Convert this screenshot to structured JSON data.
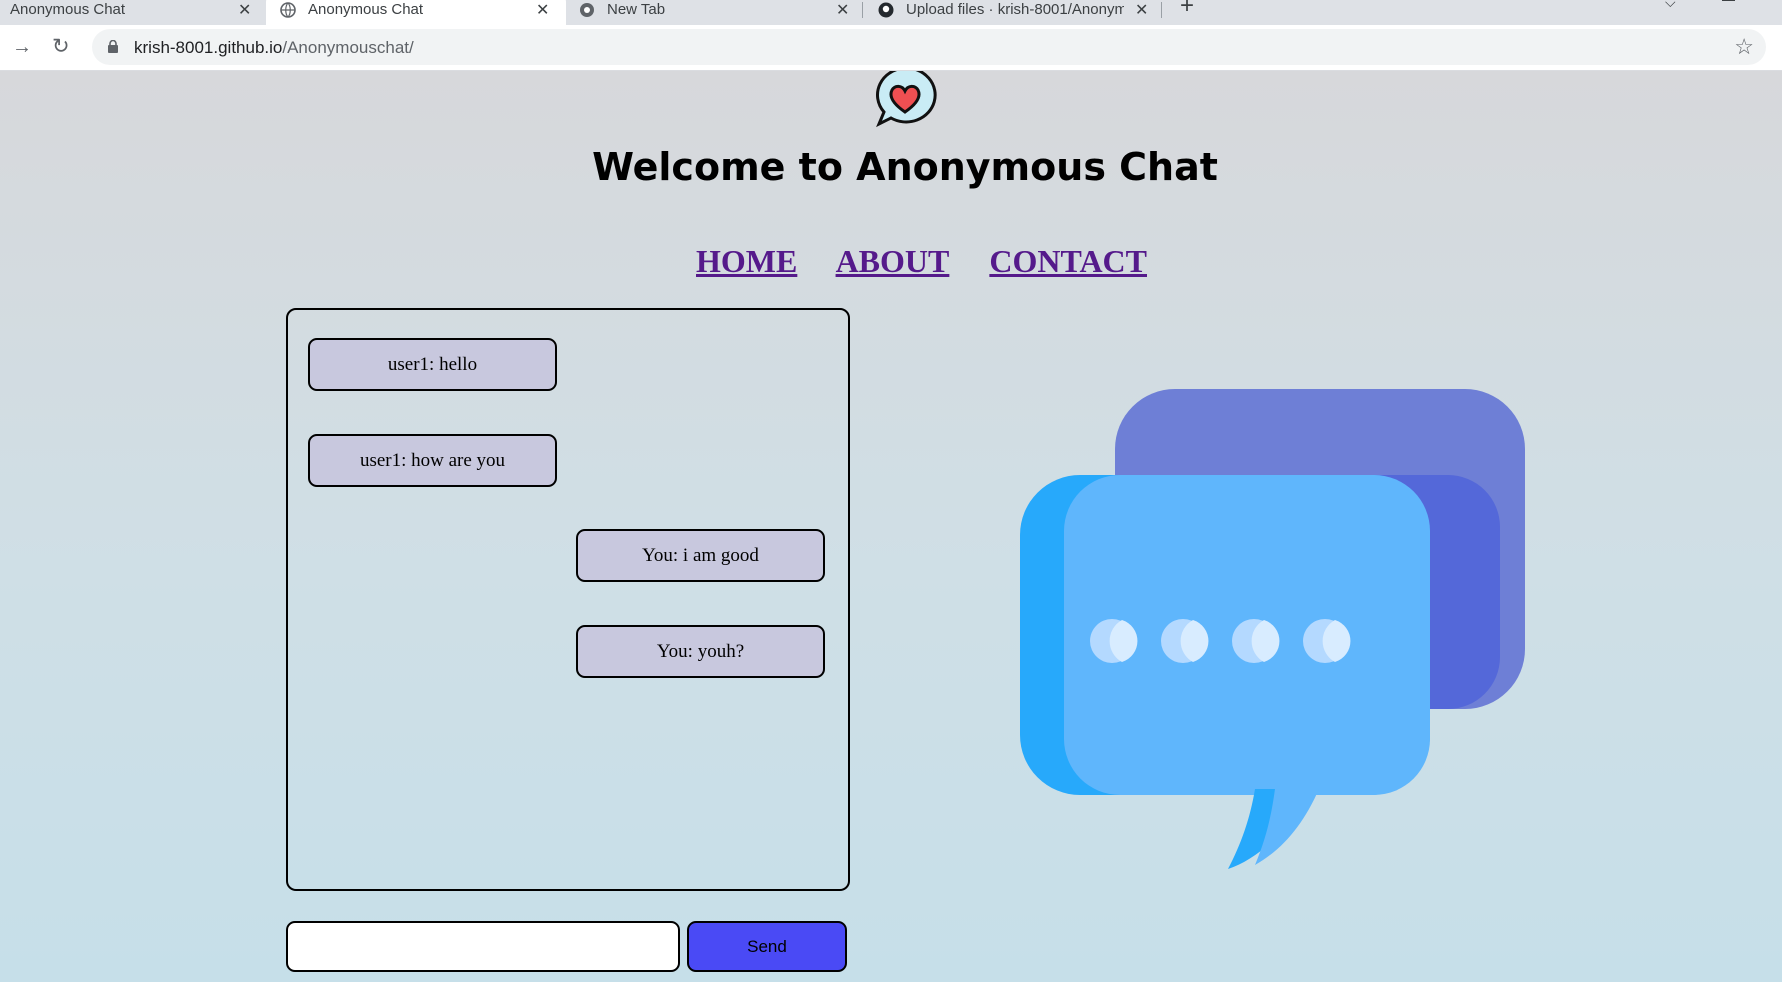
{
  "browser": {
    "tabs": [
      {
        "title": "Anonymous Chat",
        "active": false
      },
      {
        "title": "Anonymous Chat",
        "active": true
      },
      {
        "title": "New Tab",
        "active": false
      },
      {
        "title": "Upload files · krish-8001/Anonym",
        "active": false
      }
    ],
    "url_host": "krish-8001.github.io",
    "url_path": "/Anonymouschat/",
    "icons": {
      "new_tab": "plus-icon",
      "forward": "arrow-right-icon",
      "reload": "reload-icon",
      "secure": "lock-icon",
      "bookmark": "star-icon",
      "tab_close": "close-icon"
    }
  },
  "page": {
    "title": "Welcome to Anonymous Chat",
    "logo_icon": "chat-heart-icon",
    "nav": {
      "home": "HOME",
      "about": "ABOUT",
      "contact": "CONTACT"
    },
    "messages": [
      {
        "text": "user1: hello",
        "from": "other"
      },
      {
        "text": "user1: how are you",
        "from": "other"
      },
      {
        "text": "You: i am good",
        "from": "self"
      },
      {
        "text": "You: youh?",
        "from": "self"
      }
    ],
    "input": {
      "value": "",
      "placeholder": ""
    },
    "send_label": "Send",
    "illustration_icon": "chat-bubbles-icon",
    "colors": {
      "send_button": "#4a4af5",
      "message_bubble": "#c8c8de",
      "link": "#551a8b",
      "bubble_back": "#6e7fd6",
      "bubble_front": "#5fb6fc"
    }
  }
}
